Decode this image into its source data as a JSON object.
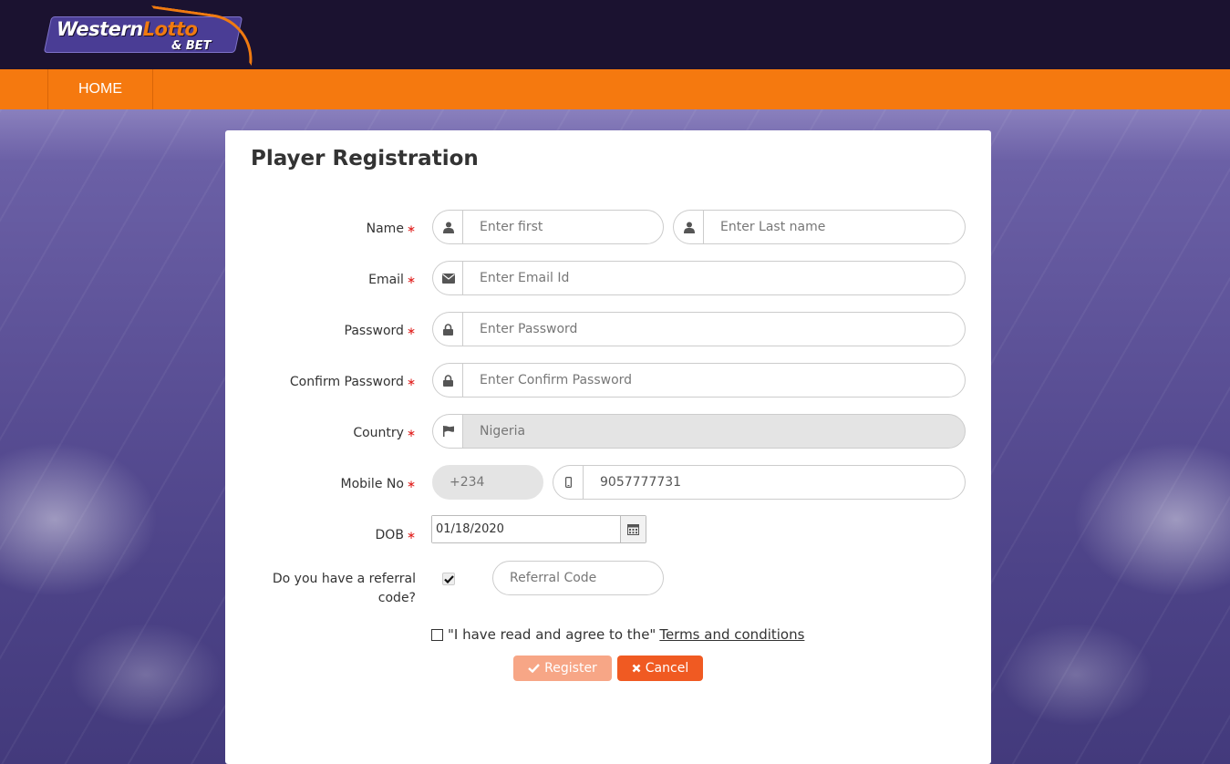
{
  "header": {
    "logo": {
      "line1_a": "Western",
      "line1_b": "Lotto",
      "line2": "& BET"
    }
  },
  "nav": {
    "home": "HOME"
  },
  "form": {
    "title": "Player Registration",
    "required_mark": "∗",
    "name": {
      "label": "Name",
      "first_placeholder": "Enter first",
      "last_placeholder": "Enter Last name"
    },
    "email": {
      "label": "Email",
      "placeholder": "Enter Email Id"
    },
    "password": {
      "label": "Password",
      "placeholder": "Enter Password"
    },
    "confirm": {
      "label": "Confirm Password",
      "placeholder": "Enter Confirm Password"
    },
    "country": {
      "label": "Country",
      "value": "Nigeria"
    },
    "mobile": {
      "label": "Mobile No",
      "code": "+234",
      "value": "9057777731"
    },
    "dob": {
      "label": "DOB",
      "value": "01/18/2020"
    },
    "referral": {
      "label": "Do you have a referral code?",
      "checked": true,
      "placeholder": "Referral Code"
    },
    "terms": {
      "text": "\"I have read and agree to the\"",
      "link": "Terms and conditions",
      "checked": false
    },
    "buttons": {
      "register": "Register",
      "cancel": "Cancel"
    }
  },
  "colors": {
    "header_bg": "#1b1230",
    "nav_bg": "#f5790f",
    "register_btn": "#f7a686",
    "cancel_btn": "#f05a22",
    "required": "#e0201e"
  }
}
